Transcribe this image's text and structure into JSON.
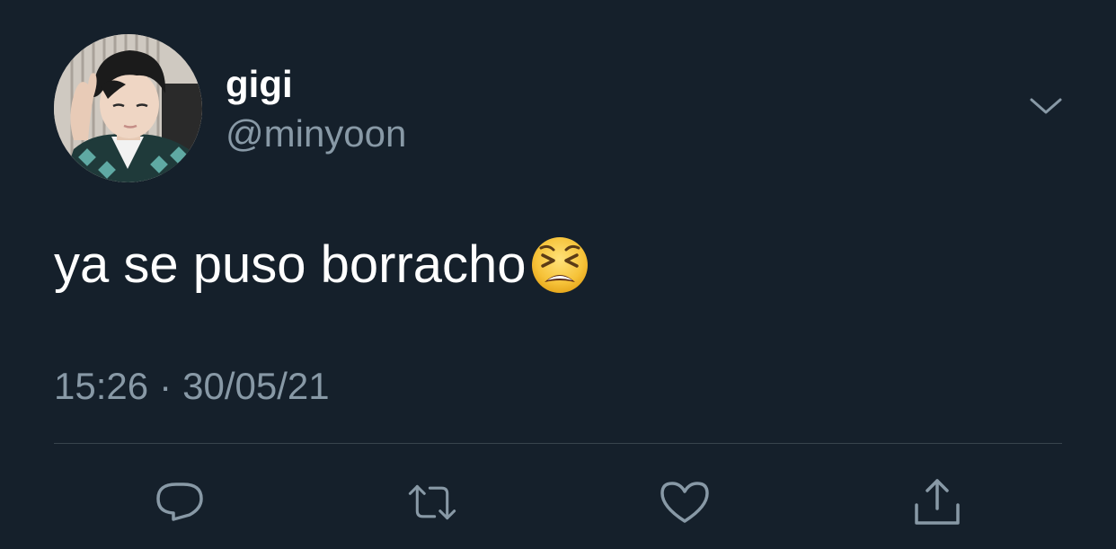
{
  "tweet": {
    "display_name": "gigi",
    "handle": "@minyoon",
    "text": "ya se puso borracho",
    "emoji": "tired-face",
    "time": "15:26",
    "separator": "·",
    "date": "30/05/21"
  },
  "actions": [
    "reply",
    "retweet",
    "like",
    "share"
  ],
  "colors": {
    "background": "#15202b",
    "primary_text": "#ffffff",
    "secondary_text": "#8899a6",
    "divider": "#38444d"
  }
}
